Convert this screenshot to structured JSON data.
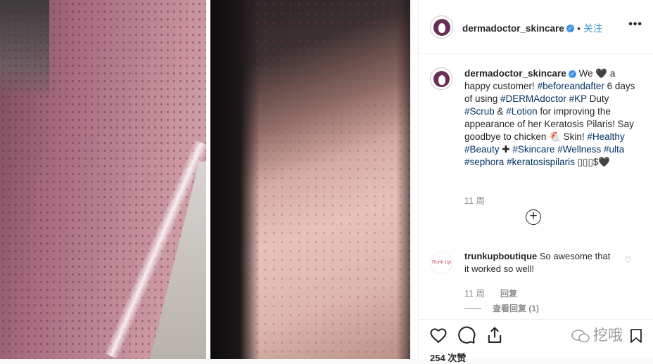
{
  "post": {
    "username": "dermadoctor_skincare",
    "follow_label": "关注",
    "more_label": "•••",
    "verified_mark": "✓"
  },
  "caption": {
    "username": "dermadoctor_skincare",
    "text_1": " We 🖤 a happy customer! ",
    "tag_beforeandafter": "#beforeandafter",
    "text_2": " 6 days of using ",
    "tag_dermadoctor": "#DERMAdoctor",
    "tag_kp": "#KP",
    "text_3": " Duty ",
    "tag_scrub": "#Scrub",
    "text_4": " & ",
    "tag_lotion": "#Lotion",
    "text_5": " for improving the appearance of her Keratosis Pilaris! Say goodbye to chicken 🐔 Skin! ",
    "tag_healthy": "#Healthy",
    "tag_beauty": "#Beauty",
    "text_6": " ✚ ",
    "tag_skincare": "#Skincare",
    "tag_wellness": "#Wellness",
    "tag_ulta": "#ulta",
    "tag_sephora": "#sephora",
    "tag_kpilaris": "#keratosispilaris",
    "text_7": " ▯▯▯$🖤",
    "time": "11 周"
  },
  "load_more_symbol": "+",
  "comment": {
    "username": "trunkupboutique",
    "avatar_text": "Trunk Up",
    "text": " So awesome that it worked so well!",
    "time": "11 周",
    "reply_label": "回复",
    "view_replies_label": "查看回复 (1)",
    "heart": "♡"
  },
  "footer": {
    "likes_label": "254 次赞",
    "watermark_text": "挖哦"
  },
  "icons": [
    "heart-icon",
    "comment-icon",
    "share-icon",
    "bookmark-icon",
    "more-icon",
    "verified-badge-icon",
    "plus-circle-icon"
  ]
}
